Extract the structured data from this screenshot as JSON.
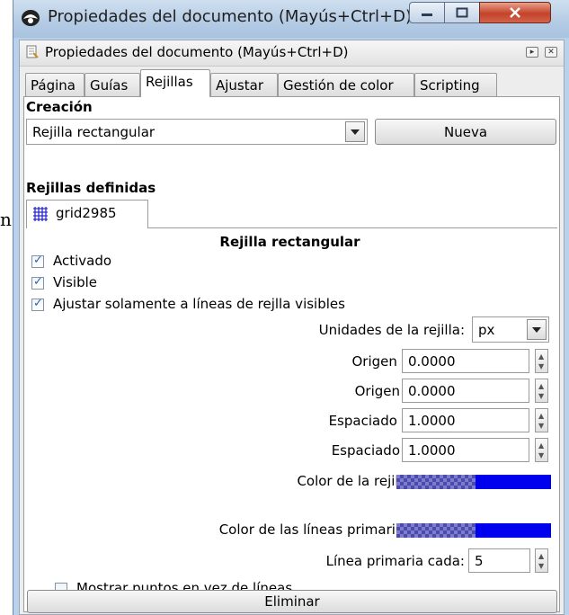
{
  "background_doc": {
    "char": "n"
  },
  "window": {
    "title": "Propiedades del documento (Mayús+Ctrl+D)",
    "controls": {
      "minimize": "—",
      "maximize": "□",
      "close": "✕"
    }
  },
  "dock": {
    "title": "Propiedades del documento (Mayús+Ctrl+D)",
    "btn_expand": "▸",
    "btn_close": "✕"
  },
  "tabs": [
    {
      "label": "Página",
      "active": false
    },
    {
      "label": "Guías",
      "active": false
    },
    {
      "label": "Rejillas",
      "active": true
    },
    {
      "label": "Ajustar",
      "active": false
    },
    {
      "label": "Gestión de color",
      "active": false
    },
    {
      "label": "Scripting",
      "active": false
    }
  ],
  "creation": {
    "heading": "Creación",
    "grid_type": "Rejilla rectangular",
    "new_button": "Nueva"
  },
  "defined": {
    "heading": "Rejillas definidas",
    "grid_tab": "grid2985"
  },
  "grid": {
    "heading": "Rejilla rectangular",
    "enabled": {
      "label": "Activado",
      "checked": true
    },
    "visible": {
      "label": "Visible",
      "checked": true
    },
    "snap_visible": {
      "label": "Ajustar solamente a líneas de rejlla visibles",
      "checked": true
    },
    "units": {
      "label": "Unidades de la rejilla:",
      "value": "px"
    },
    "origin_x": {
      "label": "Origen X:",
      "value": "0.0000"
    },
    "origin_y": {
      "label": "Origen Y:",
      "value": "0.0000"
    },
    "spacing_x": {
      "label": "Espaciado X:",
      "value": "1.0000"
    },
    "spacing_y": {
      "label": "Espaciado Y:",
      "value": "1.0000"
    },
    "grid_color": {
      "label": "Color de la rejilla:",
      "color": "#0000ee"
    },
    "major_color": {
      "label": "Color de las líneas primarias:",
      "color": "#0000ee"
    },
    "major_every": {
      "label": "Línea primaria cada:",
      "value": "5"
    },
    "show_dots": {
      "label": "Mostrar puntos en vez de líneas",
      "checked": false
    }
  },
  "delete_button": "Eliminar"
}
